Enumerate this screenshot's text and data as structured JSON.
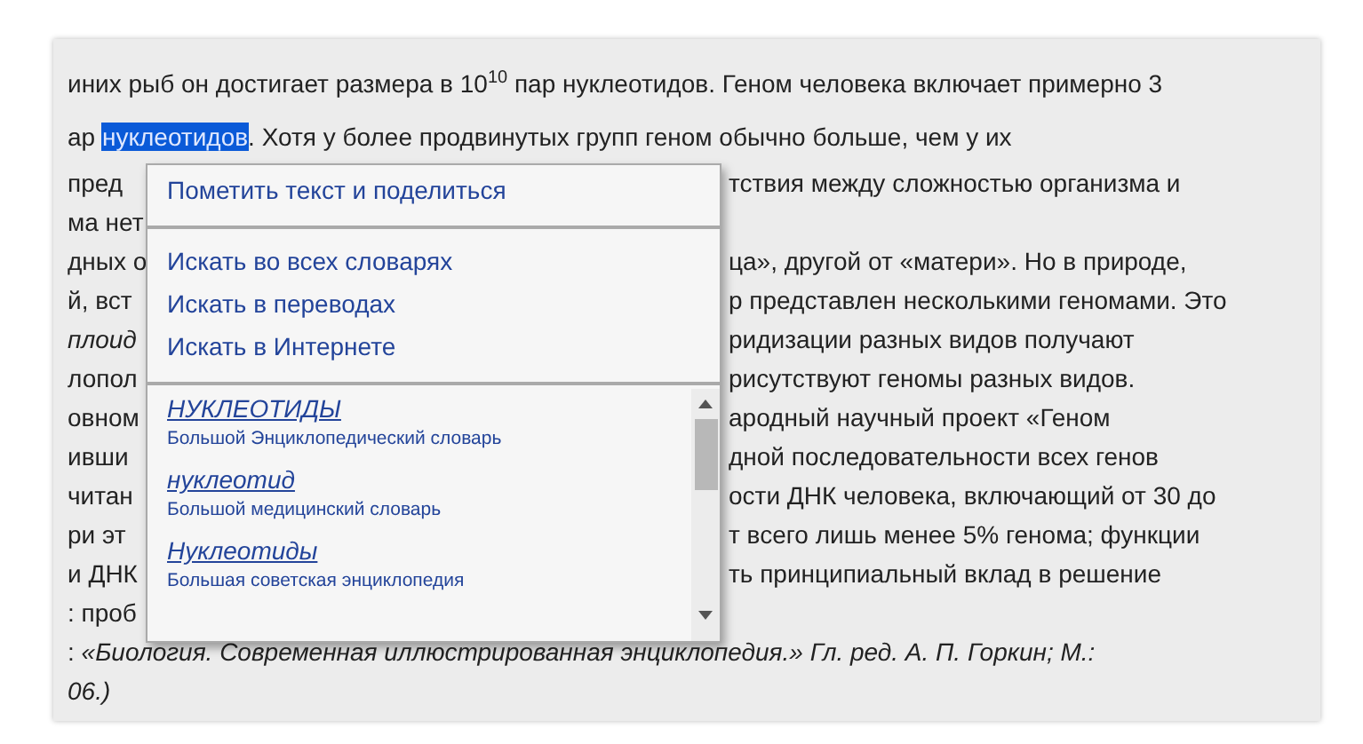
{
  "article_lines": [
    {
      "left": "иних рыб он достигает размера в 10$^{10}$ пар нуклеотидов. Геном человека включает примерно 3"
    },
    {
      "left": "ар ",
      "selected_word": "нуклеотидов",
      "after": ". Хотя у более продвинутых групп геном обычно больше, чем у их"
    },
    {
      "left": "пред",
      "right": "тствия между сложностью организма и"
    },
    {
      "left": "ма нет"
    },
    {
      "left": "дных о",
      "right": "ца», другой от «матери». Но в природе,"
    },
    {
      "left": "й, вст",
      "right": "р представлен несколькими геномами. Это"
    },
    {
      "left": "*плоид*",
      "right": "ридизации разных видов получают"
    },
    {
      "left": "лопол",
      "right": "рисутствуют геномы разных видов."
    },
    {
      "left": "овном",
      "right": "ародный научный проект «Геном"
    },
    {
      "left": "ивши",
      "right": "дной последовательности всех генов"
    },
    {
      "left": "читан",
      "right": "ости ДНК человека, включающий от 30 до"
    },
    {
      "left": "ри эт",
      "right": "т всего лишь менее 5% генома; функции"
    },
    {
      "left": "и ДНК",
      "right": "ть принципиальный вклад в решение"
    },
    {
      "left": ": проб"
    },
    {
      "left": ": *«Биология. Современная иллюстрированная энциклопедия.» Гл. ред. А. П. Горкин; М.:*"
    },
    {
      "left": "*06.)*"
    }
  ],
  "context_menu": {
    "share_item": "Пометить текст и поделиться",
    "search_items": [
      "Искать во всех словарях",
      "Искать в переводах",
      "Искать в Интернете"
    ],
    "dictionary_results": [
      {
        "term": "НУКЛЕОТИДЫ",
        "source": "Большой Энциклопедический словарь"
      },
      {
        "term": "нуклеотид",
        "source": "Большой медицинский словарь"
      },
      {
        "term": "Нуклеотиды",
        "source": "Большая советская энциклопедия"
      }
    ]
  }
}
